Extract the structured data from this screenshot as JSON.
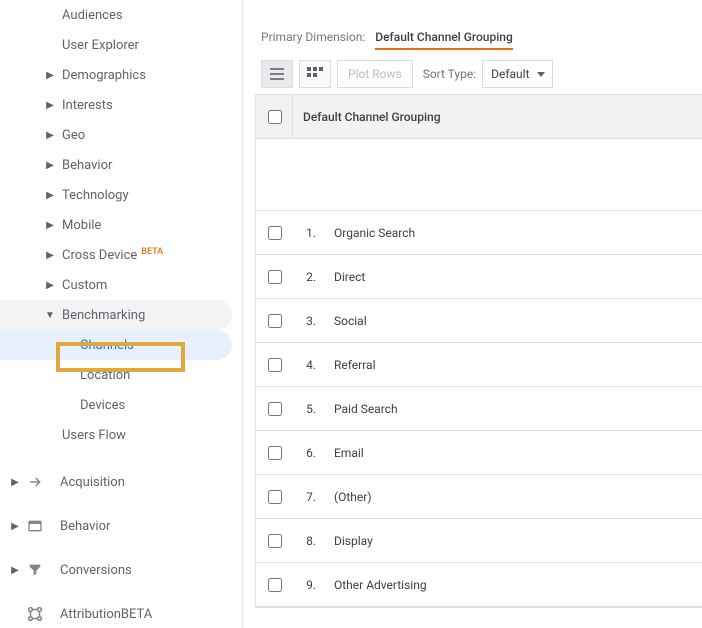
{
  "sidebar": {
    "audiences": "Audiences",
    "user_explorer": "User Explorer",
    "items": [
      {
        "label": "Demographics"
      },
      {
        "label": "Interests"
      },
      {
        "label": "Geo"
      },
      {
        "label": "Behavior"
      },
      {
        "label": "Technology"
      },
      {
        "label": "Mobile"
      },
      {
        "label": "Cross Device",
        "badge": "BETA"
      },
      {
        "label": "Custom"
      }
    ],
    "benchmarking": {
      "label": "Benchmarking",
      "children": [
        {
          "label": "Channels"
        },
        {
          "label": "Location"
        },
        {
          "label": "Devices"
        }
      ]
    },
    "users_flow": "Users Flow",
    "sections": [
      {
        "label": "Acquisition"
      },
      {
        "label": "Behavior"
      },
      {
        "label": "Conversions"
      },
      {
        "label": "Attribution",
        "badge": "BETA"
      }
    ]
  },
  "main": {
    "primary_dimension_label": "Primary Dimension:",
    "primary_dimension_value": "Default Channel Grouping",
    "plot_rows": "Plot Rows",
    "sort_type_label": "Sort Type:",
    "sort_type_value": "Default",
    "table_header": "Default Channel Grouping",
    "rows": [
      {
        "n": "1.",
        "name": "Organic Search"
      },
      {
        "n": "2.",
        "name": "Direct"
      },
      {
        "n": "3.",
        "name": "Social"
      },
      {
        "n": "4.",
        "name": "Referral"
      },
      {
        "n": "5.",
        "name": "Paid Search"
      },
      {
        "n": "6.",
        "name": "Email"
      },
      {
        "n": "7.",
        "name": "(Other)"
      },
      {
        "n": "8.",
        "name": "Display"
      },
      {
        "n": "9.",
        "name": "Other Advertising"
      }
    ]
  }
}
